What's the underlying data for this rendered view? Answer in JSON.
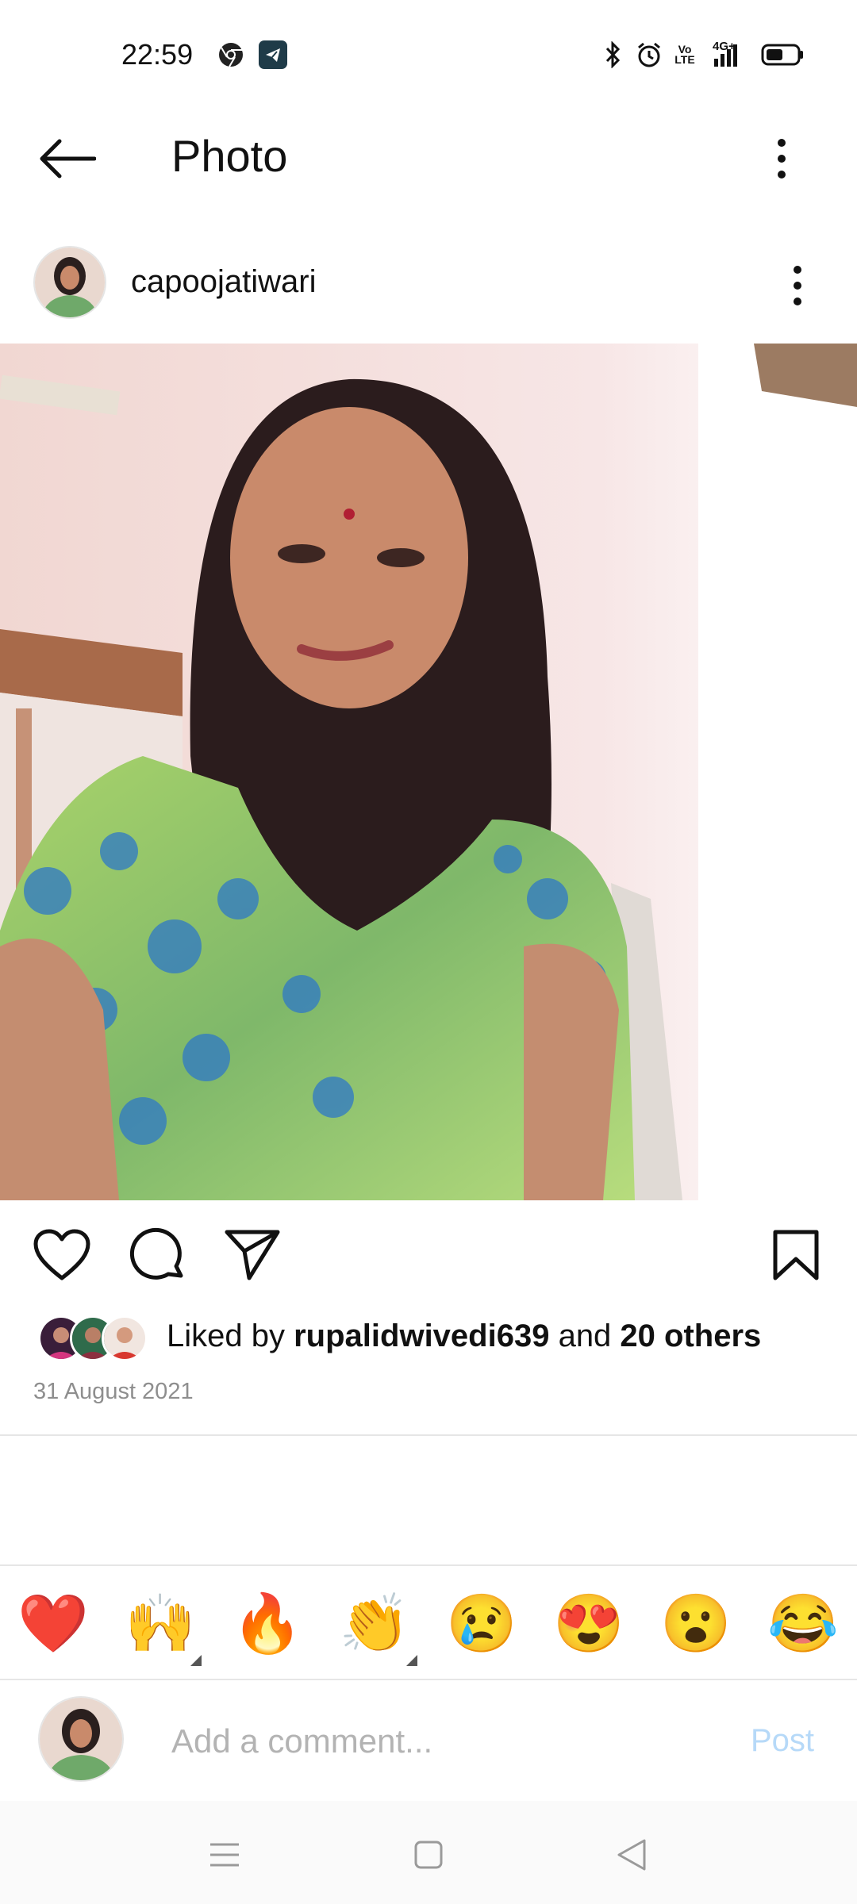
{
  "status_bar": {
    "time": "22:59",
    "icons": [
      "chrome-icon",
      "telegram-icon",
      "bluetooth-icon",
      "alarm-icon",
      "volte-icon",
      "4g-signal-icon",
      "battery-icon"
    ],
    "volte_label_top": "Vo",
    "volte_label_bottom": "LTE",
    "network_label": "4G+"
  },
  "header": {
    "title": "Photo"
  },
  "post": {
    "username": "capoojatiwari",
    "likes_prefix": "Liked by ",
    "liked_by_user": "rupalidwivedi639",
    "likes_joiner": " and ",
    "likes_others": "20 others",
    "date": "31 August 2021"
  },
  "reactions": {
    "emojis": [
      "❤️",
      "🙌",
      "🔥",
      "👏",
      "😢",
      "😍",
      "😮",
      "😂"
    ]
  },
  "comment_bar": {
    "placeholder": "Add a comment...",
    "post_label": "Post"
  },
  "colors": {
    "post_button": "#b6d9f8",
    "date_text": "#8e8e8e"
  }
}
